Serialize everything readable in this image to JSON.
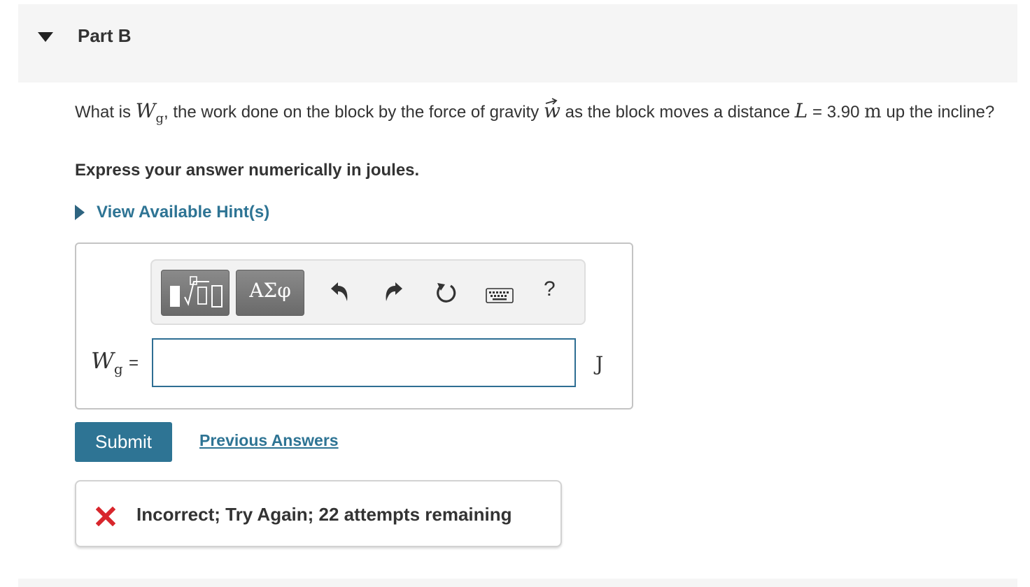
{
  "part": {
    "title": "Part B"
  },
  "question": {
    "text_1": "What is ",
    "var_w": "W",
    "var_w_sub": "g",
    "text_2": ", the work done on the block by the force of gravity ",
    "vec_w": "w",
    "text_3": " as the block moves a distance ",
    "var_L": "L",
    "text_4": " = 3.90 ",
    "unit_m": "m",
    "text_5": " up the incline?"
  },
  "instruction": "Express your answer numerically in joules.",
  "hint": {
    "label": "View Available Hint(s)"
  },
  "toolbar": {
    "templates_icon": "templates-icon",
    "symbols_label": "ΑΣφ",
    "undo_icon": "undo-icon",
    "redo_icon": "redo-icon",
    "reset_icon": "reset-icon",
    "keyboard_icon": "keyboard-icon",
    "help_label": "?"
  },
  "answer": {
    "var": "W",
    "var_sub": "g",
    "equals": "=",
    "value": "",
    "unit": "J"
  },
  "actions": {
    "submit_label": "Submit",
    "previous_answers_label": "Previous Answers"
  },
  "feedback": {
    "icon": "incorrect-x-icon",
    "text": "Incorrect; Try Again; 22 attempts remaining"
  },
  "colors": {
    "accent": "#2e7494",
    "incorrect": "#d8262c",
    "header_bg": "#f5f5f5"
  }
}
